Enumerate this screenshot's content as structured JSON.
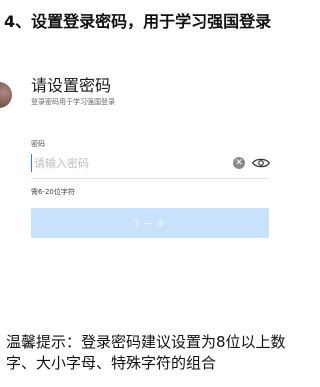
{
  "heading": "4、设置登录密码，用于学习强国登录",
  "screen": {
    "title": "请设置密码",
    "subtitle": "登录密码用于学习强国登录",
    "password_label": "密码",
    "password_placeholder": "请输入密码",
    "password_value": "",
    "clear_icon": "clear-circle-icon",
    "visibility_icon": "eye-icon",
    "hint": "需6-20位字符",
    "next_button": "下一步"
  },
  "tip": "温馨提示：登录密码建议设置为8位以上数字、大小字母、特殊字符的组合",
  "colors": {
    "button_bg": "#c9e2fb",
    "cursor": "#3478f6"
  }
}
